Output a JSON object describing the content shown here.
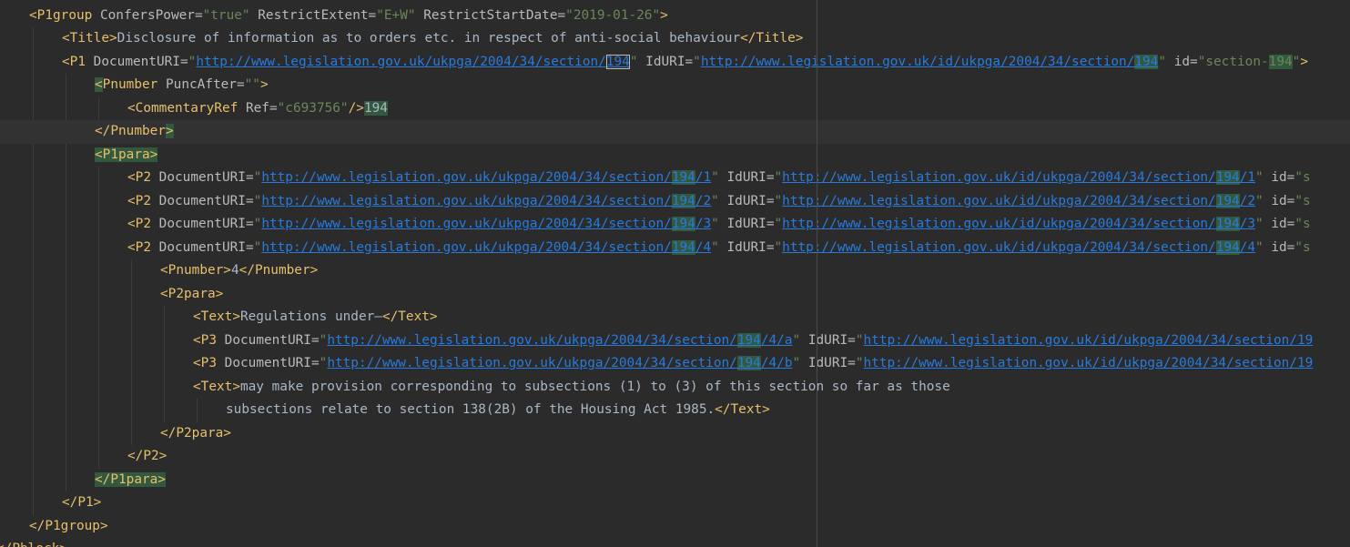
{
  "editor": {
    "lines": [
      {
        "indent": 1,
        "segs": [
          [
            "t",
            "<P1group"
          ],
          [
            "a",
            " ConfersPower="
          ],
          [
            "v",
            "\"true\""
          ],
          [
            "a",
            " RestrictExtent="
          ],
          [
            "v",
            "\"E+W\""
          ],
          [
            "a",
            " RestrictStartDate="
          ],
          [
            "v",
            "\"2019-01-26\""
          ],
          [
            "t",
            ">"
          ]
        ]
      },
      {
        "indent": 2,
        "segs": [
          [
            "t",
            "<Title>"
          ],
          [
            "x",
            "Disclosure of information as to orders etc. in respect of anti-social behaviour"
          ],
          [
            "t",
            "</Title>"
          ]
        ]
      },
      {
        "indent": 2,
        "segs": [
          [
            "t",
            "<P1"
          ],
          [
            "a",
            " DocumentURI="
          ],
          [
            "v",
            "\""
          ],
          [
            "u",
            "http://www.legislation.gov.uk/ukpga/2004/34/section/"
          ],
          [
            "ub",
            "194"
          ],
          [
            "v",
            "\""
          ],
          [
            "a",
            " IdURI="
          ],
          [
            "v",
            "\""
          ],
          [
            "u",
            "http://www.legislation.gov.uk/id/ukpga/2004/34/section/"
          ],
          [
            "uh",
            "194"
          ],
          [
            "v",
            "\""
          ],
          [
            "a",
            " id="
          ],
          [
            "v",
            "\"section-"
          ],
          [
            "vh",
            "194"
          ],
          [
            "v",
            "\""
          ],
          [
            "t",
            ">"
          ]
        ]
      },
      {
        "indent": 3,
        "segs": [
          [
            "th",
            "<"
          ],
          [
            "t",
            "Pnumber"
          ],
          [
            "a",
            " PuncAfter="
          ],
          [
            "v",
            "\"\""
          ],
          [
            "t",
            ">"
          ]
        ]
      },
      {
        "indent": 4,
        "segs": [
          [
            "t",
            "<CommentaryRef"
          ],
          [
            "a",
            " Ref="
          ],
          [
            "v",
            "\"c693756\""
          ],
          [
            "t",
            "/>"
          ],
          [
            "xh",
            "194"
          ]
        ]
      },
      {
        "indent": 3,
        "current": true,
        "segs": [
          [
            "t",
            "</Pnumber"
          ],
          [
            "th",
            ">"
          ]
        ]
      },
      {
        "indent": 3,
        "segs": [
          [
            "th",
            "<P1para>"
          ]
        ]
      },
      {
        "indent": 4,
        "segs": [
          [
            "t",
            "<P2"
          ],
          [
            "a",
            " DocumentURI="
          ],
          [
            "v",
            "\""
          ],
          [
            "u",
            "http://www.legislation.gov.uk/ukpga/2004/34/section/"
          ],
          [
            "uh",
            "194"
          ],
          [
            "u",
            "/1"
          ],
          [
            "v",
            "\""
          ],
          [
            "a",
            " IdURI="
          ],
          [
            "v",
            "\""
          ],
          [
            "u",
            "http://www.legislation.gov.uk/id/ukpga/2004/34/section/"
          ],
          [
            "uh",
            "194"
          ],
          [
            "u",
            "/1"
          ],
          [
            "v",
            "\""
          ],
          [
            "a",
            " id="
          ],
          [
            "v",
            "\"s"
          ]
        ]
      },
      {
        "indent": 4,
        "segs": [
          [
            "t",
            "<P2"
          ],
          [
            "a",
            " DocumentURI="
          ],
          [
            "v",
            "\""
          ],
          [
            "u",
            "http://www.legislation.gov.uk/ukpga/2004/34/section/"
          ],
          [
            "uh",
            "194"
          ],
          [
            "u",
            "/2"
          ],
          [
            "v",
            "\""
          ],
          [
            "a",
            " IdURI="
          ],
          [
            "v",
            "\""
          ],
          [
            "u",
            "http://www.legislation.gov.uk/id/ukpga/2004/34/section/"
          ],
          [
            "uh",
            "194"
          ],
          [
            "u",
            "/2"
          ],
          [
            "v",
            "\""
          ],
          [
            "a",
            " id="
          ],
          [
            "v",
            "\"s"
          ]
        ]
      },
      {
        "indent": 4,
        "segs": [
          [
            "t",
            "<P2"
          ],
          [
            "a",
            " DocumentURI="
          ],
          [
            "v",
            "\""
          ],
          [
            "u",
            "http://www.legislation.gov.uk/ukpga/2004/34/section/"
          ],
          [
            "uh",
            "194"
          ],
          [
            "u",
            "/3"
          ],
          [
            "v",
            "\""
          ],
          [
            "a",
            " IdURI="
          ],
          [
            "v",
            "\""
          ],
          [
            "u",
            "http://www.legislation.gov.uk/id/ukpga/2004/34/section/"
          ],
          [
            "uh",
            "194"
          ],
          [
            "u",
            "/3"
          ],
          [
            "v",
            "\""
          ],
          [
            "a",
            " id="
          ],
          [
            "v",
            "\"s"
          ]
        ]
      },
      {
        "indent": 4,
        "segs": [
          [
            "t",
            "<P2"
          ],
          [
            "a",
            " DocumentURI="
          ],
          [
            "v",
            "\""
          ],
          [
            "u",
            "http://www.legislation.gov.uk/ukpga/2004/34/section/"
          ],
          [
            "uh",
            "194"
          ],
          [
            "u",
            "/4"
          ],
          [
            "v",
            "\""
          ],
          [
            "a",
            " IdURI="
          ],
          [
            "v",
            "\""
          ],
          [
            "u",
            "http://www.legislation.gov.uk/id/ukpga/2004/34/section/"
          ],
          [
            "uh",
            "194"
          ],
          [
            "u",
            "/4"
          ],
          [
            "v",
            "\""
          ],
          [
            "a",
            " id="
          ],
          [
            "v",
            "\"s"
          ]
        ]
      },
      {
        "indent": 5,
        "segs": [
          [
            "t",
            "<Pnumber>"
          ],
          [
            "x",
            "4"
          ],
          [
            "t",
            "</Pnumber>"
          ]
        ]
      },
      {
        "indent": 5,
        "segs": [
          [
            "t",
            "<P2para>"
          ]
        ]
      },
      {
        "indent": 6,
        "segs": [
          [
            "t",
            "<Text>"
          ],
          [
            "x",
            "Regulations under—"
          ],
          [
            "t",
            "</Text>"
          ]
        ]
      },
      {
        "indent": 6,
        "segs": [
          [
            "t",
            "<P3"
          ],
          [
            "a",
            " DocumentURI="
          ],
          [
            "v",
            "\""
          ],
          [
            "u",
            "http://www.legislation.gov.uk/ukpga/2004/34/section/"
          ],
          [
            "uh",
            "194"
          ],
          [
            "u",
            "/4/a"
          ],
          [
            "v",
            "\""
          ],
          [
            "a",
            " IdURI="
          ],
          [
            "v",
            "\""
          ],
          [
            "u",
            "http://www.legislation.gov.uk/id/ukpga/2004/34/section/19"
          ]
        ]
      },
      {
        "indent": 6,
        "segs": [
          [
            "t",
            "<P3"
          ],
          [
            "a",
            " DocumentURI="
          ],
          [
            "v",
            "\""
          ],
          [
            "u",
            "http://www.legislation.gov.uk/ukpga/2004/34/section/"
          ],
          [
            "uh",
            "194"
          ],
          [
            "u",
            "/4/b"
          ],
          [
            "v",
            "\""
          ],
          [
            "a",
            " IdURI="
          ],
          [
            "v",
            "\""
          ],
          [
            "u",
            "http://www.legislation.gov.uk/id/ukpga/2004/34/section/19"
          ]
        ]
      },
      {
        "indent": 6,
        "segs": [
          [
            "t",
            "<Text>"
          ],
          [
            "x",
            "may make provision corresponding to subsections (1) to (3) of this section so far as those"
          ]
        ]
      },
      {
        "indent": 7,
        "segs": [
          [
            "x",
            "subsections relate to section 138(2B) of the Housing Act 1985."
          ],
          [
            "t",
            "</Text>"
          ]
        ]
      },
      {
        "indent": 5,
        "segs": [
          [
            "t",
            "</P2para>"
          ]
        ]
      },
      {
        "indent": 4,
        "segs": [
          [
            "t",
            "</P2>"
          ]
        ]
      },
      {
        "indent": 3,
        "segs": [
          [
            "th",
            "</P1para>"
          ]
        ]
      },
      {
        "indent": 2,
        "segs": [
          [
            "t",
            "</P1>"
          ]
        ]
      },
      {
        "indent": 1,
        "segs": [
          [
            "t",
            "</P1group>"
          ]
        ]
      },
      {
        "indent": 0,
        "segs": [
          [
            "t",
            "</Pblock>"
          ]
        ]
      }
    ]
  },
  "colors": {
    "background": "#2b2b2b",
    "tag": "#e8bf6a",
    "attribute": "#bababa",
    "value": "#6a8759",
    "url": "#287bde",
    "text": "#a9b7c6",
    "match_highlight": "#32593d"
  }
}
